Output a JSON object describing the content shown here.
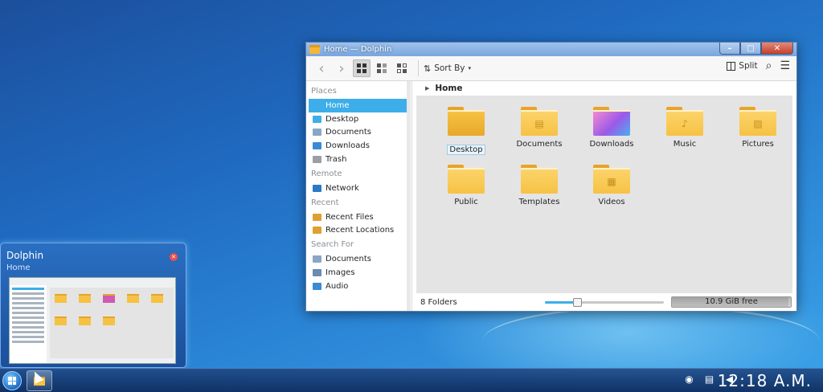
{
  "window": {
    "title": "Home — Dolphin",
    "controls": {
      "minimize": "–",
      "maximize": "□",
      "close": "✕"
    }
  },
  "toolbar": {
    "back": "‹",
    "forward": "›",
    "sort_label": "Sort By",
    "split_label": "Split",
    "search_icon": "⌕",
    "menu_icon": "☰"
  },
  "sidebar": {
    "groups": [
      {
        "label": "Places",
        "items": [
          {
            "label": "Home",
            "icon": "home-icon",
            "color": "#3daee9",
            "selected": true
          },
          {
            "label": "Desktop",
            "icon": "desktop-icon",
            "color": "#3daee9"
          },
          {
            "label": "Documents",
            "icon": "documents-icon",
            "color": "#8aa6c6"
          },
          {
            "label": "Downloads",
            "icon": "downloads-icon",
            "color": "#3a8ad6"
          },
          {
            "label": "Trash",
            "icon": "trash-icon",
            "color": "#9aa0a6"
          }
        ]
      },
      {
        "label": "Remote",
        "items": [
          {
            "label": "Network",
            "icon": "network-icon",
            "color": "#2a7ac8"
          }
        ]
      },
      {
        "label": "Recent",
        "items": [
          {
            "label": "Recent Files",
            "icon": "recent-files-icon",
            "color": "#e0a030"
          },
          {
            "label": "Recent Locations",
            "icon": "recent-locations-icon",
            "color": "#e0a030"
          }
        ]
      },
      {
        "label": "Search For",
        "items": [
          {
            "label": "Documents",
            "icon": "search-documents-icon",
            "color": "#8aa6c6"
          },
          {
            "label": "Images",
            "icon": "images-icon",
            "color": "#6a8ab0"
          },
          {
            "label": "Audio",
            "icon": "audio-icon",
            "color": "#3a8ad6"
          }
        ]
      }
    ]
  },
  "breadcrumb": {
    "arrow": "▶",
    "location": "Home"
  },
  "files": [
    {
      "label": "Desktop",
      "icon": "desktop-folder-icon",
      "glyph": "",
      "selected": true
    },
    {
      "label": "Documents",
      "icon": "documents-folder-icon",
      "glyph": "▤"
    },
    {
      "label": "Downloads",
      "icon": "downloads-folder-icon",
      "glyph": ""
    },
    {
      "label": "Music",
      "icon": "music-folder-icon",
      "glyph": "♪"
    },
    {
      "label": "Pictures",
      "icon": "pictures-folder-icon",
      "glyph": "▨"
    },
    {
      "label": "Public",
      "icon": "public-folder-icon",
      "glyph": ""
    },
    {
      "label": "Templates",
      "icon": "templates-folder-icon",
      "glyph": ""
    },
    {
      "label": "Videos",
      "icon": "videos-folder-icon",
      "glyph": "▦"
    }
  ],
  "status": {
    "folder_count": "8 Folders",
    "zoom_level": 0.27,
    "free_space": "10.9 GiB free",
    "disk_used_fraction": 0.98
  },
  "thumbnail": {
    "title": "Dolphin",
    "subtitle": "Home",
    "close": "✕"
  },
  "taskbar": {
    "clock": "12:18 A.M."
  },
  "colors": {
    "accent": "#3daee9",
    "folder": "#f6c244",
    "folder_tab": "#e8a32b"
  }
}
